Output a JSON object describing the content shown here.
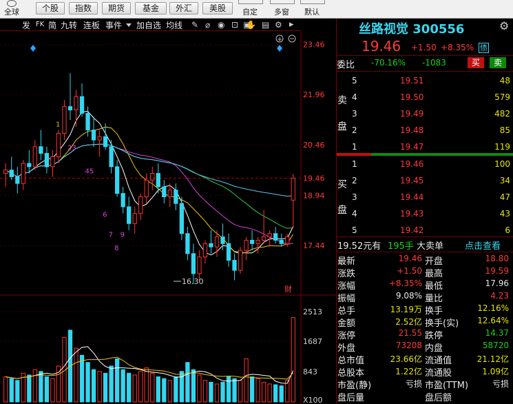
{
  "toolbar": {
    "labels": [
      "全球",
      "个股",
      "指数",
      "期货",
      "基金",
      "外汇",
      "美股",
      "自定",
      "多窗",
      "默认"
    ]
  },
  "chart_toolbar": {
    "items": [
      "发",
      "FK",
      "简",
      "九转",
      "连板",
      "事件",
      "加自选",
      "均线",
      "叠",
      "窗",
      "预测",
      "更多"
    ]
  },
  "stock": {
    "name_code": "丝路视觉 300556",
    "price": "19.46",
    "change": "+1.50",
    "change_pct": "+8.35%",
    "badge": "债"
  },
  "order_ratio": {
    "label": "委比",
    "pct": "-70.16%",
    "diff": "-1083",
    "sell_btn": "买",
    "buy_btn": "卖"
  },
  "asks": [
    {
      "level": "5",
      "price": "19.51",
      "vol": "48"
    },
    {
      "level": "4",
      "price": "19.50",
      "vol": "579"
    },
    {
      "level": "3",
      "price": "19.49",
      "vol": "482"
    },
    {
      "level": "2",
      "price": "19.48",
      "vol": "85"
    },
    {
      "level": "1",
      "price": "19.47",
      "vol": "119"
    }
  ],
  "bids": [
    {
      "level": "1",
      "price": "19.46",
      "vol": "100"
    },
    {
      "level": "2",
      "price": "19.45",
      "vol": "34"
    },
    {
      "level": "3",
      "price": "19.44",
      "vol": "47"
    },
    {
      "level": "4",
      "price": "19.43",
      "vol": "43"
    },
    {
      "level": "5",
      "price": "19.42",
      "vol": "6"
    }
  ],
  "side_labels": {
    "sell_a": "卖",
    "sell_b": "盘",
    "buy_a": "买",
    "buy_b": "盘"
  },
  "block_trade": {
    "price": "19.52元有",
    "qty": "195手",
    "label": "大卖单",
    "link": "点击查看"
  },
  "quote": [
    {
      "k1": "最新",
      "v1": "19.46",
      "c1": "red",
      "k2": "开盘",
      "v2": "18.80",
      "c2": "red"
    },
    {
      "k1": "涨跌",
      "v1": "+1.50",
      "c1": "red",
      "k2": "最高",
      "v2": "19.59",
      "c2": "red"
    },
    {
      "k1": "涨幅",
      "v1": "+8.35%",
      "c1": "red",
      "k2": "最低",
      "v2": "17.96",
      "c2": "white"
    },
    {
      "k1": "振幅",
      "v1": "9.08%",
      "c1": "white",
      "k2": "量比",
      "v2": "4.23",
      "c2": "red"
    },
    {
      "k1": "总手",
      "v1": "13.19万",
      "c1": "yellow",
      "k2": "换手",
      "v2": "12.16%",
      "c2": "yellow"
    },
    {
      "k1": "金额",
      "v1": "2.52亿",
      "c1": "yellow",
      "k2": "换手(实)",
      "v2": "12.64%",
      "c2": "yellow"
    },
    {
      "k1": "涨停",
      "v1": "21.55",
      "c1": "red",
      "k2": "跌停",
      "v2": "14.37",
      "c2": "green"
    },
    {
      "k1": "外盘",
      "v1": "73208",
      "c1": "red",
      "k2": "内盘",
      "v2": "58720",
      "c2": "green"
    },
    {
      "k1": "总市值",
      "v1": "23.66亿",
      "c1": "yellow",
      "k2": "流通值",
      "v2": "21.12亿",
      "c2": "yellow"
    },
    {
      "k1": "总股本",
      "v1": "1.22亿",
      "c1": "yellow",
      "k2": "流通股",
      "v2": "1.09亿",
      "c2": "yellow"
    },
    {
      "k1": "市盈(静)",
      "v1": "亏损",
      "c1": "white",
      "k2": "市盈(TTM)",
      "v2": "亏损",
      "c2": "white"
    },
    {
      "k1": "盘后量",
      "v1": "",
      "c1": "white",
      "k2": "盘后额",
      "v2": "",
      "c2": "white"
    }
  ],
  "chart_data": [
    {
      "type": "candlestick",
      "y_ticks": [
        "23.46",
        "21.96",
        "20.46",
        "19.46",
        "18.94",
        "17.44"
      ],
      "ylim": [
        16.0,
        23.8
      ],
      "last_close_line": 19.46,
      "low_annotation": "16.30",
      "badge": "财",
      "wave_labels": [
        "1",
        "23",
        "45",
        "6",
        "7",
        "9",
        "8"
      ],
      "candles": [
        [
          19.6,
          19.9,
          19.2,
          19.7
        ],
        [
          19.7,
          20.1,
          19.4,
          19.5
        ],
        [
          19.5,
          19.8,
          19.0,
          19.3
        ],
        [
          19.3,
          20.0,
          19.1,
          19.9
        ],
        [
          19.9,
          20.3,
          19.6,
          19.8
        ],
        [
          19.8,
          20.6,
          19.7,
          20.4
        ],
        [
          20.4,
          20.9,
          20.0,
          20.2
        ],
        [
          20.2,
          20.4,
          19.6,
          19.8
        ],
        [
          19.8,
          20.3,
          19.5,
          20.1
        ],
        [
          20.1,
          20.9,
          19.9,
          20.8
        ],
        [
          20.8,
          21.8,
          20.6,
          21.6
        ],
        [
          21.6,
          22.6,
          21.2,
          21.5
        ],
        [
          21.5,
          22.1,
          21.0,
          21.9
        ],
        [
          21.9,
          22.3,
          21.3,
          21.4
        ],
        [
          21.4,
          21.6,
          20.7,
          20.9
        ],
        [
          20.9,
          21.3,
          20.4,
          20.6
        ],
        [
          20.6,
          20.9,
          20.1,
          20.7
        ],
        [
          20.7,
          21.1,
          20.3,
          20.4
        ],
        [
          20.4,
          20.6,
          19.6,
          19.8
        ],
        [
          19.8,
          20.0,
          18.9,
          19.0
        ],
        [
          19.0,
          19.2,
          18.4,
          18.6
        ],
        [
          18.6,
          18.9,
          17.9,
          18.1
        ],
        [
          18.1,
          18.6,
          17.8,
          18.4
        ],
        [
          18.4,
          19.0,
          18.2,
          18.9
        ],
        [
          18.9,
          19.6,
          18.7,
          19.4
        ],
        [
          19.4,
          19.8,
          19.1,
          19.6
        ],
        [
          19.6,
          19.9,
          19.0,
          19.2
        ],
        [
          19.2,
          19.4,
          18.7,
          18.9
        ],
        [
          18.9,
          19.3,
          18.6,
          19.1
        ],
        [
          19.1,
          19.3,
          18.5,
          18.7
        ],
        [
          18.7,
          18.9,
          17.6,
          17.8
        ],
        [
          17.8,
          18.0,
          17.0,
          17.2
        ],
        [
          17.2,
          17.5,
          16.3,
          16.6
        ],
        [
          16.6,
          17.3,
          16.4,
          17.1
        ],
        [
          17.1,
          17.6,
          16.9,
          17.5
        ],
        [
          17.5,
          17.9,
          17.2,
          17.4
        ],
        [
          17.4,
          17.9,
          17.1,
          17.7
        ],
        [
          17.7,
          18.1,
          17.3,
          17.5
        ],
        [
          17.5,
          17.8,
          16.8,
          17.0
        ],
        [
          17.0,
          17.2,
          16.4,
          16.7
        ],
        [
          16.7,
          17.4,
          16.6,
          17.3
        ],
        [
          17.3,
          17.7,
          17.0,
          17.6
        ],
        [
          17.6,
          17.9,
          17.3,
          17.5
        ],
        [
          17.5,
          17.7,
          17.2,
          17.6
        ],
        [
          17.6,
          18.5,
          17.5,
          17.7
        ],
        [
          17.7,
          17.9,
          17.4,
          17.8
        ],
        [
          17.8,
          18.0,
          17.5,
          17.6
        ],
        [
          17.6,
          17.8,
          17.4,
          17.5
        ],
        [
          17.5,
          17.8,
          17.4,
          17.7
        ],
        [
          18.8,
          19.59,
          17.96,
          19.46
        ]
      ]
    },
    {
      "type": "bar",
      "y_ticks": [
        "2513",
        "1687",
        "843",
        "X100"
      ],
      "ylim": [
        0,
        2900
      ],
      "values": [
        700,
        650,
        600,
        800,
        750,
        900,
        850,
        700,
        650,
        1000,
        1800,
        2000,
        1500,
        1300,
        1100,
        900,
        850,
        800,
        1000,
        1200,
        900,
        800,
        750,
        850,
        950,
        800,
        700,
        650,
        600,
        700,
        850,
        1100,
        900,
        750,
        600,
        550,
        500,
        550,
        700,
        650,
        600,
        1200,
        700,
        650,
        550,
        500,
        480,
        450,
        600,
        2350
      ]
    }
  ]
}
